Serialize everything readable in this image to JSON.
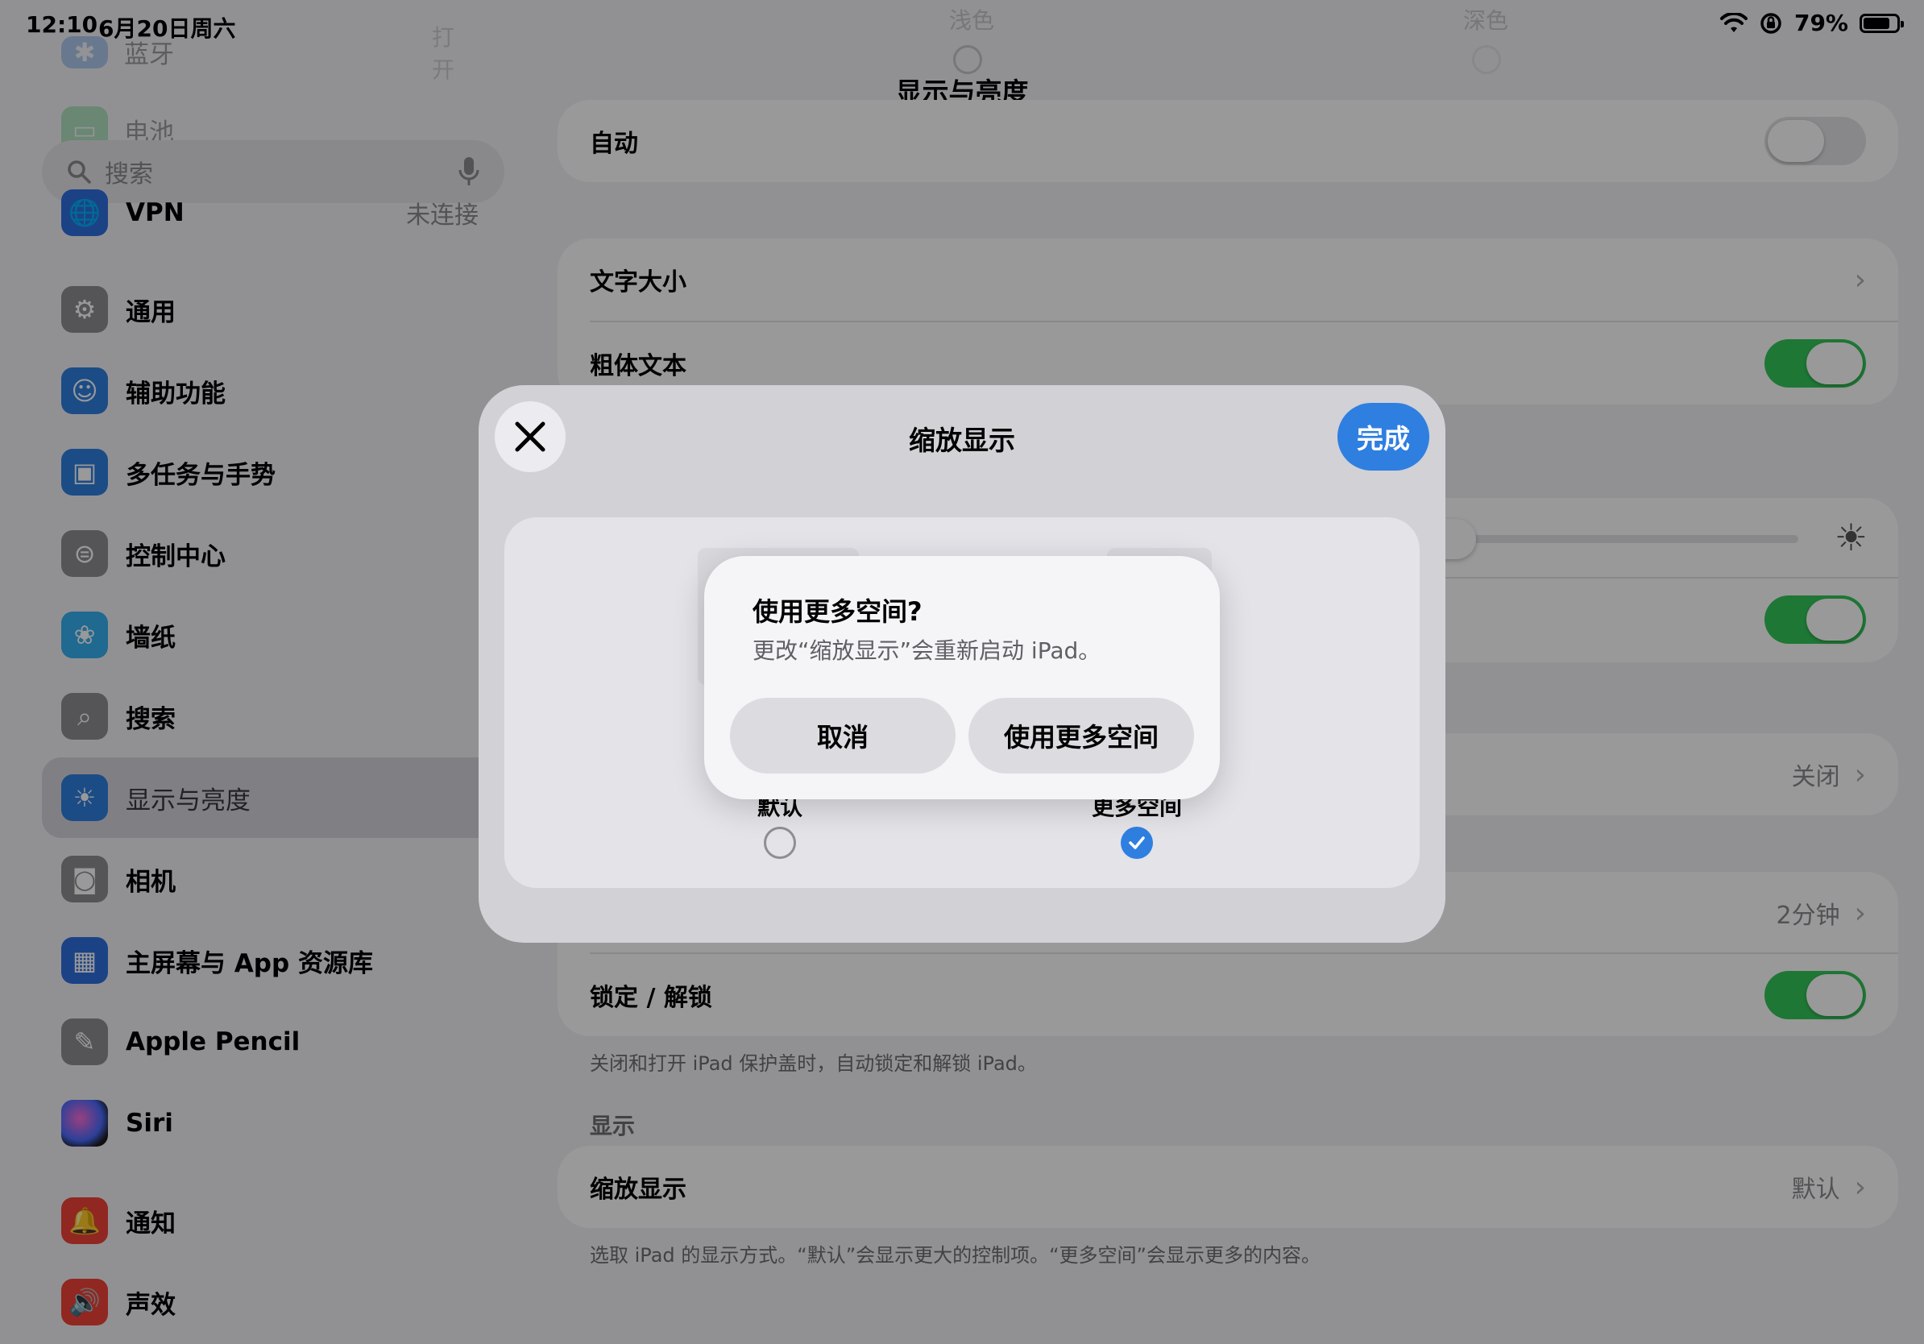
{
  "status_bar": {
    "time": "12:10",
    "date": "6月20日周六",
    "battery": "79%",
    "battery_level": 0.79
  },
  "sidebar": {
    "ghost_rows": [
      {
        "label": "蓝牙",
        "value": "打开"
      },
      {
        "label": "电池"
      }
    ],
    "search_placeholder": "搜索",
    "items": [
      {
        "label": "VPN",
        "value": "未连接",
        "icon": "vpn-icon",
        "color": "#2f6fe0"
      },
      {
        "label": "通用",
        "icon": "gear-icon",
        "color": "#8e8e93"
      },
      {
        "label": "辅助功能",
        "icon": "accessibility-icon",
        "color": "#2f7fe0"
      },
      {
        "label": "多任务与手势",
        "icon": "multitask-icon",
        "color": "#2f7fe0"
      },
      {
        "label": "控制中心",
        "icon": "control-center-icon",
        "color": "#8e8e93"
      },
      {
        "label": "墙纸",
        "icon": "wallpaper-icon",
        "color": "#36b0f0"
      },
      {
        "label": "搜索",
        "icon": "search-icon",
        "color": "#8e8e93"
      },
      {
        "label": "显示与亮度",
        "icon": "brightness-icon",
        "color": "#2f7fe0"
      },
      {
        "label": "相机",
        "icon": "camera-icon",
        "color": "#8e8e93"
      },
      {
        "label": "主屏幕与 App 资源库",
        "icon": "home-screen-icon",
        "color": "#2f6fe0"
      },
      {
        "label": "Apple Pencil",
        "icon": "pencil-icon",
        "color": "#8e8e93"
      },
      {
        "label": "Siri",
        "icon": "siri-icon",
        "color": "#1c1c1e"
      },
      {
        "label": "通知",
        "icon": "bell-icon",
        "color": "#f04438"
      },
      {
        "label": "声效",
        "icon": "speaker-icon",
        "color": "#f04438"
      }
    ]
  },
  "main": {
    "title": "显示与亮度",
    "ghost": {
      "light": "浅色",
      "dark": "深色"
    },
    "auto_label": "自动",
    "text_size_label": "文字大小",
    "bold_text_label": "粗体文本",
    "night_shift_value": "关闭",
    "auto_lock_value": "2分钟",
    "lock_unlock_label": "锁定 / 解锁",
    "lock_unlock_footnote": "关闭和打开 iPad 保护盖时，自动锁定和解锁 iPad。",
    "display_header": "显示",
    "zoom_label": "缩放显示",
    "zoom_value": "默认",
    "zoom_footnote": "选取 iPad 的显示方式。“默认”会显示更大的控制项。“更多空间”会显示更多的内容。"
  },
  "sheet": {
    "title": "缩放显示",
    "done_label": "完成",
    "option_default": "默认",
    "option_more": "更多空间",
    "selected": "更多空间"
  },
  "alert": {
    "title": "使用更多空间?",
    "message": "更改“缩放显示”会重新启动 iPad。",
    "cancel_label": "取消",
    "confirm_label": "使用更多空间"
  }
}
